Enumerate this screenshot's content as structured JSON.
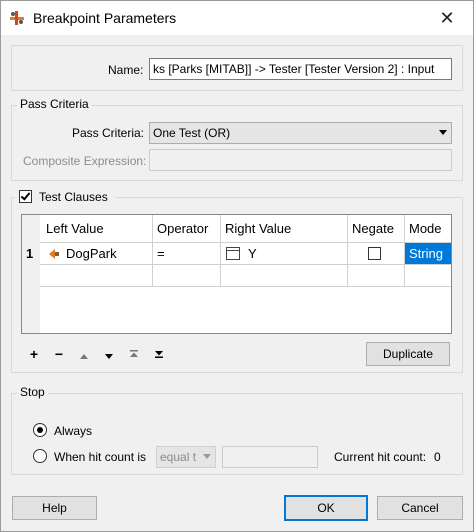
{
  "window": {
    "title": "Breakpoint Parameters",
    "close_glyph": "✕"
  },
  "name_field": {
    "label": "Name:",
    "value": "ks [Parks [MITAB]] -> Tester [Tester Version 2] : Input"
  },
  "pass_criteria": {
    "group_title": "Pass Criteria",
    "criteria_label": "Pass Criteria:",
    "criteria_value": "One Test (OR)",
    "composite_label": "Composite Expression:",
    "composite_value": ""
  },
  "test_clauses": {
    "group_title": "Test Clauses",
    "checked": true,
    "columns": [
      "Left Value",
      "Operator",
      "Right Value",
      "Negate",
      "Mode"
    ],
    "rows": [
      {
        "number": "1",
        "left_icon": "attribute-icon",
        "left_value": "DogPark",
        "operator": "=",
        "right_icon": "text-value-icon",
        "right_value": "Y",
        "negate": false,
        "mode": "String"
      }
    ],
    "toolbar": {
      "add": "+",
      "remove": "−",
      "move_up_icon": "arrow-up-icon",
      "move_down_icon": "arrow-down-icon",
      "move_top_icon": "move-top-icon",
      "move_bottom_icon": "move-bottom-icon",
      "duplicate_label": "Duplicate"
    }
  },
  "stop": {
    "group_title": "Stop",
    "always_label": "Always",
    "always_selected": true,
    "hit_count_label": "When hit count is",
    "hit_count_selected": false,
    "hit_operator_value": "equal t",
    "hit_value": "",
    "current_hit_label": "Current hit count:",
    "current_hit_value": "0"
  },
  "footer": {
    "help_label": "Help",
    "ok_label": "OK",
    "cancel_label": "Cancel"
  },
  "colors": {
    "selection": "#0078d7",
    "window_bg": "#f0f0f0"
  }
}
